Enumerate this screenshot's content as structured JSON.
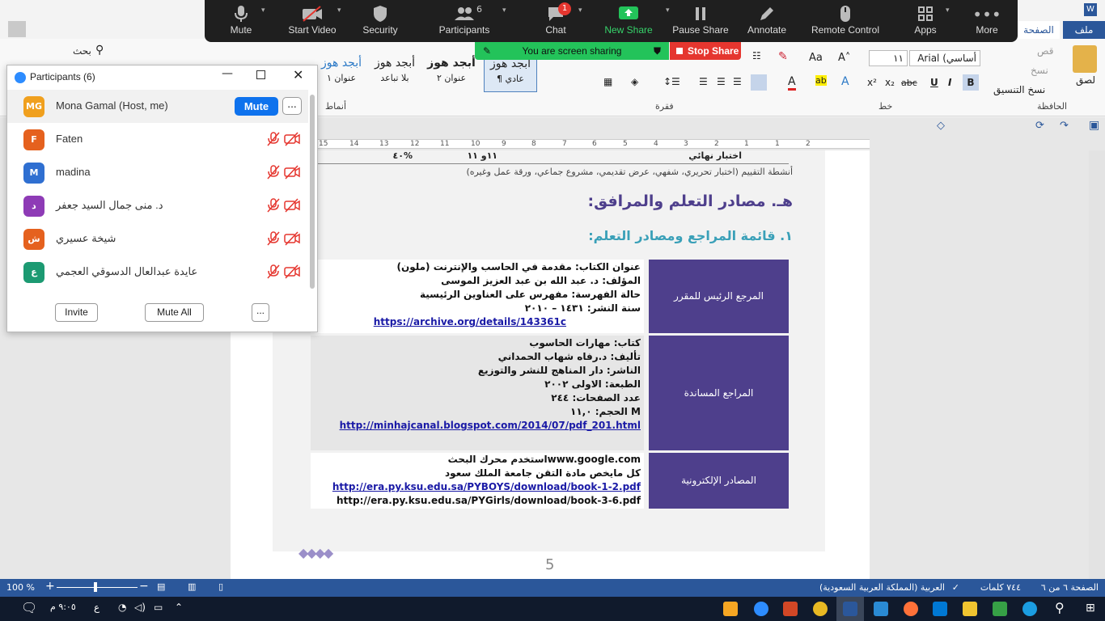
{
  "ribbon": {
    "tabs": [
      {
        "label": "ملف"
      },
      {
        "label": "الصفحة"
      }
    ],
    "clipboard": {
      "paste": "لصق",
      "cut": "قص",
      "copy": "نسخ",
      "format_painter": "نسخ التنسيق",
      "group": "الحافظة"
    },
    "font": {
      "name": "أساسي) Arial",
      "size": "١١",
      "group": "خط"
    },
    "paragraph": {
      "group": "فقرة"
    },
    "styles": {
      "group": "أنماط",
      "items": [
        {
          "preview": "أبجد هوز",
          "name": "¶ عادي"
        },
        {
          "preview": "أبجد هوز",
          "name": "عنوان ٢"
        },
        {
          "preview": "أبجد هوز",
          "name": "بلا تباعد"
        },
        {
          "preview": "أبجد هوز",
          "name": "عنوان ١"
        }
      ]
    },
    "search": "بحث"
  },
  "zoom": {
    "mute": "Mute",
    "start_video": "Start Video",
    "security": "Security",
    "participants": "Participants",
    "participants_count": "6",
    "chat": "Chat",
    "chat_badge": "1",
    "new_share": "New Share",
    "pause_share": "Pause Share",
    "annotate": "Annotate",
    "remote_control": "Remote Control",
    "apps": "Apps",
    "more": "More",
    "sharing_banner": "You are screen sharing",
    "stop_share": "Stop Share"
  },
  "participants_panel": {
    "title": "Participants (6)",
    "rows": [
      {
        "initials": "MG",
        "name": "Mona Gamal (Host, me)",
        "color": "#f0a01e"
      },
      {
        "initials": "F",
        "name": "Faten",
        "color": "#e5611e"
      },
      {
        "initials": "M",
        "name": "madina",
        "color": "#2f6fd1"
      },
      {
        "initials": "د",
        "name": "د. منى جمال السيد جعفر",
        "color": "#8e3bb6"
      },
      {
        "initials": "ش",
        "name": "شيخة عسيري",
        "color": "#e5611e"
      },
      {
        "initials": "ع",
        "name": "عايدة عبدالعال الدسوقي العجمي",
        "color": "#1c9a72"
      }
    ],
    "mute_button": "Mute",
    "more_button": "...",
    "invite": "Invite",
    "mute_all": "Mute All"
  },
  "document": {
    "top_row_label": "اختبار نهائي",
    "top_row_week": "١١و ١١",
    "top_row_pct": "%٤٠",
    "assessment_note": "أنشطة التقييم (اختبار تحريري، شفهي، عرض تقديمي، مشروع جماعي، ورقة عمل وغيره)",
    "heading_h": "هـ. مصادر التعلم والمرافق:",
    "heading_1": "١. قائمة المراجع ومصادر التعلم:",
    "rows": [
      {
        "label": "المرجع الرئيس للمقرر",
        "lines": [
          "عنوان الكتاب: مقدمة في الحاسب والإنترنت (ملون)",
          "المؤلف: د. عبد الله بن عبد العزيز الموسى",
          "حالة الفهرسة: مفهرس على العناوين الرئيسية",
          "سنة النشر: ١٤٣١ – ٢٠١٠"
        ],
        "link": "https://archive.org/details/143361c"
      },
      {
        "label": "المراجع المساندة",
        "lines": [
          "كتاب: مهارات الحاسوب",
          "تأليف: د.رفاه شهاب الحمداني",
          "الناشر: دار المناهج للنشر والتوزيع",
          "الطبعة: الاولى ٢٠٠٢",
          "عدد الصفحات: ٢٤٤",
          "M الحجم: ١١,٠"
        ],
        "link": "http://minhajcanal.blogspot.com/2014/07/pdf_201.html"
      },
      {
        "label": "المصادر الإلكترونية",
        "lines": [
          "www.google.comاستخدم محرك البحث",
          "كل مايخص مادة التقن جامعة الملك سعود"
        ],
        "link": "http://era.py.ksu.edu.sa/PYBOYS/download/book-1-2.pdf",
        "extra": "http://era.py.ksu.edu.sa/PYGirls/download/book-3-6.pdf"
      }
    ],
    "page_number": "5"
  },
  "ruler_numbers": [
    "15",
    "14",
    "13",
    "12",
    "11",
    "10",
    "9",
    "8",
    "7",
    "6",
    "5",
    "4",
    "3",
    "2",
    "1",
    "1",
    "2"
  ],
  "statusbar": {
    "zoom": "100 %",
    "page": "الصفحة ٦ من ٦",
    "words": "٧٤٤ كلمات",
    "language": "العربية (المملكة العربية السعودية)"
  },
  "taskbar": {
    "time": "٩:٠٥ م",
    "lang": "ع"
  },
  "colors": {
    "zoom_bg": "#1f1f1f",
    "table_purple": "#4e3f8c",
    "heading_purple": "#4e3f8c",
    "heading_teal": "#3aa0b8",
    "word_blue": "#2b579a",
    "share_green": "#23c35a",
    "stop_red": "#e5362f",
    "mute_blue": "#0e72ed"
  }
}
